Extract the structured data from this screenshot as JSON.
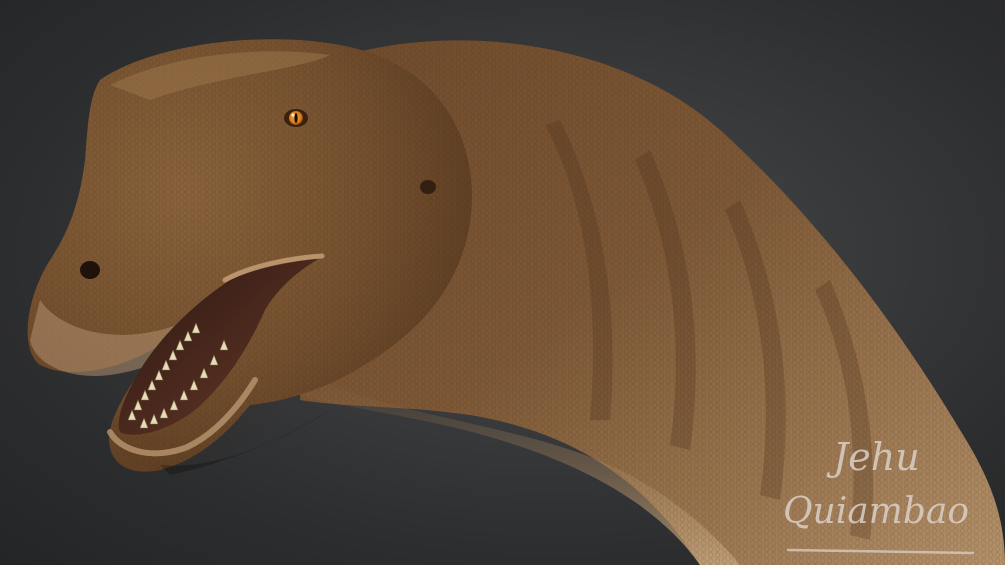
{
  "image": {
    "subject": "sauropod-dinosaur-head-and-neck-render",
    "background_color": "#343537",
    "skin_base_color": "#7a5734",
    "skin_light_color": "#b8966b",
    "eye_color": "#e08a1c",
    "teeth_color": "#e6dcb8"
  },
  "watermark": {
    "line1": "Jehu",
    "line2": "Quiambao",
    "color": "#d9d0c8"
  }
}
